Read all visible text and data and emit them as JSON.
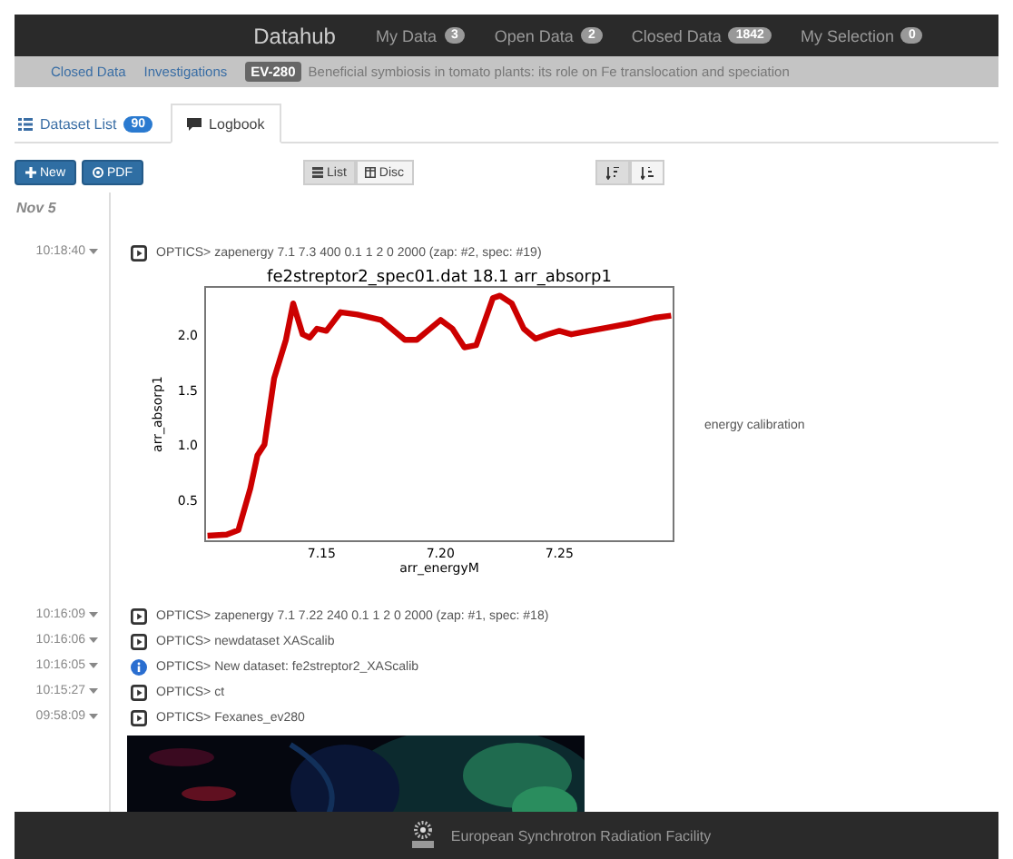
{
  "navbar": {
    "brand": "Datahub",
    "links": [
      {
        "label": "My Data",
        "count": "3"
      },
      {
        "label": "Open Data",
        "count": "2"
      },
      {
        "label": "Closed Data",
        "count": "1842"
      },
      {
        "label": "My Selection",
        "count": "0"
      }
    ]
  },
  "breadcrumb": {
    "links": [
      "Closed Data",
      "Investigations"
    ],
    "tag": "EV-280",
    "title": "Beneficial symbiosis in tomato plants: its role on Fe translocation and speciation"
  },
  "tabs": [
    {
      "label": "Dataset List",
      "count": "90",
      "selected": false
    },
    {
      "label": "Logbook",
      "selected": true
    }
  ],
  "toolbar": {
    "buttons": [
      "New",
      "PDF"
    ],
    "views": [
      {
        "label": "List",
        "selected": true
      },
      {
        "label": "Disc",
        "selected": false
      }
    ],
    "sort": [
      {
        "kind": "descending",
        "selected": true
      },
      {
        "kind": "ascending",
        "selected": false
      }
    ]
  },
  "logbook": {
    "date": "Nov 5",
    "entries": [
      {
        "time": "10:18:40",
        "kind": "command",
        "text": "OPTICS> zapenergy 7.1 7.3 400 0.1 1 2 0 2000 (zap: #2, spec: #19)",
        "note": "energy calibration",
        "chart_data": {
          "type": "line",
          "title": "fe2streptor2_spec01.dat 18.1 arr_absorp1",
          "xlabel": "arr_energyM",
          "ylabel": "arr_absorp1",
          "x": [
            7.102,
            7.11,
            7.115,
            7.12,
            7.123,
            7.126,
            7.13,
            7.135,
            7.138,
            7.142,
            7.145,
            7.148,
            7.152,
            7.158,
            7.165,
            7.175,
            7.185,
            7.19,
            7.2,
            7.205,
            7.21,
            7.215,
            7.222,
            7.225,
            7.23,
            7.235,
            7.24,
            7.245,
            7.25,
            7.255,
            7.26,
            7.27,
            7.28,
            7.29,
            7.297
          ],
          "series": [
            {
              "color": "#cc0000",
              "values": [
                0.17,
                0.18,
                0.22,
                0.6,
                0.9,
                1.0,
                1.6,
                1.95,
                2.28,
                2.0,
                1.97,
                2.05,
                2.03,
                2.2,
                2.18,
                2.13,
                1.95,
                1.95,
                2.13,
                2.05,
                1.88,
                1.9,
                2.33,
                2.35,
                2.28,
                2.05,
                1.96,
                2.0,
                2.03,
                2.0,
                2.02,
                2.06,
                2.1,
                2.15,
                2.17
              ]
            }
          ],
          "xlim": [
            7.101,
            7.298
          ],
          "ylim": [
            0.12,
            2.43
          ],
          "xticks": [
            {
              "value": 7.15,
              "label": "7.15"
            },
            {
              "value": 7.2,
              "label": "7.20"
            },
            {
              "value": 7.25,
              "label": "7.25"
            }
          ],
          "yticks": [
            {
              "value": 0.5,
              "label": "0.5"
            },
            {
              "value": 1.0,
              "label": "1.0"
            },
            {
              "value": 1.5,
              "label": "1.5"
            },
            {
              "value": 2.0,
              "label": "2.0"
            }
          ]
        }
      },
      {
        "time": "10:16:09",
        "kind": "command",
        "text": "OPTICS> zapenergy 7.1 7.22 240 0.1 1 2 0 2000 (zap: #1, spec: #18)"
      },
      {
        "time": "10:16:06",
        "kind": "command",
        "text": "OPTICS> newdataset XAScalib"
      },
      {
        "time": "10:16:05",
        "kind": "info",
        "text": "OPTICS> New dataset: fe2streptor2_XAScalib"
      },
      {
        "time": "10:15:27",
        "kind": "command",
        "text": "OPTICS> ct"
      },
      {
        "time": "09:58:09",
        "kind": "command",
        "text": "OPTICS> Fexanes_ev280"
      }
    ]
  },
  "footer": {
    "text": "European Synchrotron Radiation Facility"
  }
}
